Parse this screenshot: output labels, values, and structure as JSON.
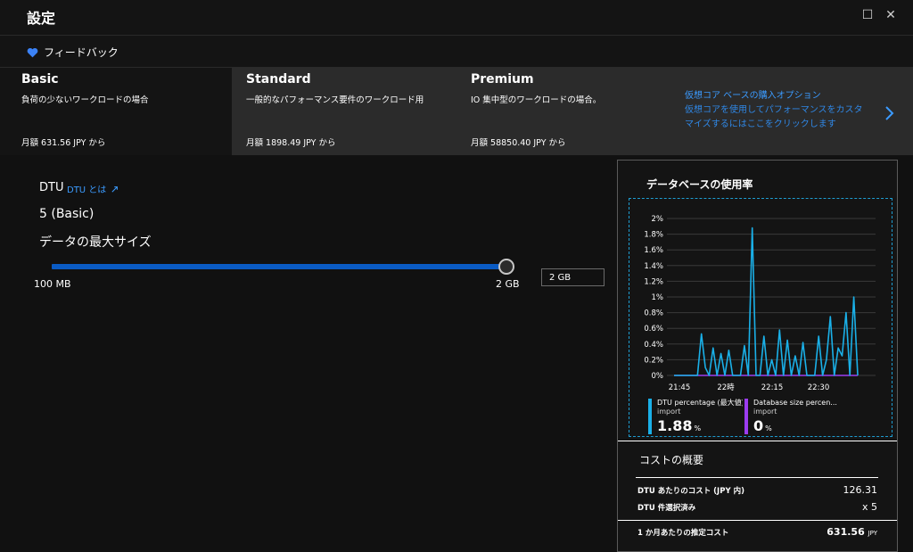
{
  "window": {
    "title": "設定",
    "maximize_glyph": "☐",
    "close_glyph": "✕"
  },
  "feedback": {
    "label": "フィードバック",
    "icon": "heart-icon",
    "color": "#3b82f6"
  },
  "tiers": [
    {
      "name": "Basic",
      "desc": "負荷の少ないワークロードの場合",
      "price": "月額 631.56 JPY から",
      "selected": true
    },
    {
      "name": "Standard",
      "desc": "一般的なパフォーマンス要件のワークロード用",
      "price": "月額 1898.49 JPY から",
      "selected": false
    },
    {
      "name": "Premium",
      "desc": "IO 集中型のワークロードの場合。",
      "price": "月額 58850.40 JPY から",
      "selected": false
    }
  ],
  "vcore": {
    "line1": "仮想コア ベースの購入オプション",
    "line2": "仮想コアを使用してパフォーマンスをカスタ",
    "line3": "マイズするにはここをクリックします"
  },
  "dtu": {
    "label": "DTU",
    "link": "DTU とは",
    "value": "5 (Basic)"
  },
  "max_size": {
    "label": "データの最大サイズ",
    "min": "100 MB",
    "max": "2 GB",
    "input_value": "2 GB",
    "slider_fraction": 1.0
  },
  "usage": {
    "title": "データベースの使用率"
  },
  "chart_data": {
    "type": "line",
    "x_ticks": [
      "21:45",
      "22時",
      "22:15",
      "22:30"
    ],
    "y_ticks": [
      "0%",
      "0.2%",
      "0.4%",
      "0.6%",
      "0.8%",
      "1%",
      "1.2%",
      "1.4%",
      "1.6%",
      "1.8%",
      "2%"
    ],
    "ylim": [
      0,
      2
    ],
    "series": [
      {
        "name": "DTU percentage (最大値)",
        "sub": "import",
        "color": "#1ab0e8",
        "values": [
          0,
          0,
          0,
          0,
          0,
          0,
          0,
          0.53,
          0.1,
          0,
          0.35,
          0,
          0.28,
          0,
          0.32,
          0,
          0,
          0,
          0.38,
          0,
          1.88,
          0,
          0,
          0.5,
          0,
          0.2,
          0,
          0.58,
          0,
          0.45,
          0,
          0.25,
          0,
          0.42,
          0,
          0,
          0,
          0.5,
          0,
          0.2,
          0.75,
          0,
          0.35,
          0.25,
          0.8,
          0,
          1.0,
          0
        ]
      },
      {
        "name": "Database size percen...",
        "sub": "import",
        "color": "#9b3cf0",
        "values": [
          0,
          0,
          0,
          0,
          0,
          0,
          0,
          0,
          0,
          0,
          0,
          0,
          0,
          0,
          0,
          0,
          0,
          0,
          0,
          0,
          0,
          0,
          0,
          0,
          0,
          0,
          0,
          0,
          0,
          0,
          0,
          0,
          0,
          0,
          0,
          0,
          0,
          0,
          0,
          0,
          0,
          0,
          0,
          0,
          0,
          0,
          0,
          0
        ]
      }
    ],
    "legend": [
      {
        "name": "DTU percentage (最大値)",
        "sub": "import",
        "value": "1.88",
        "unit": "%",
        "color": "#1ab0e8"
      },
      {
        "name": "Database size percen...",
        "sub": "import",
        "value": "0",
        "unit": "%",
        "color": "#9b3cf0"
      }
    ]
  },
  "cost": {
    "title": "コストの概要",
    "rows": [
      {
        "label": "DTU あたりのコスト (JPY 内)",
        "value": "126.31"
      },
      {
        "label": "DTU 件選択済み",
        "value": "x 5"
      },
      {
        "label": "1 か月あたりの推定コスト",
        "value": "631.56",
        "unit": "JPY"
      }
    ]
  }
}
